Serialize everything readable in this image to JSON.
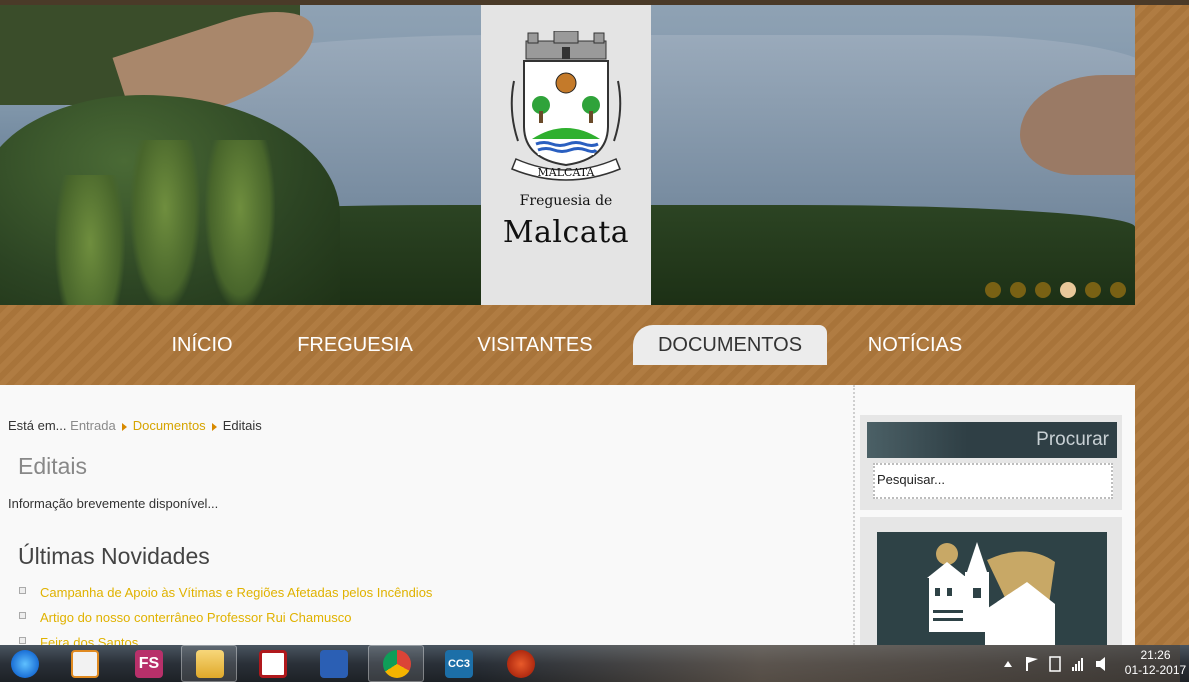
{
  "brand": {
    "subtitle": "Freguesia de",
    "name": "Malcata",
    "crest_ribbon": "MALCATA"
  },
  "slider": {
    "total": 6,
    "active": 4
  },
  "nav": {
    "items": [
      {
        "label": "INÍCIO"
      },
      {
        "label": "FREGUESIA"
      },
      {
        "label": "VISITANTES"
      },
      {
        "label": "DOCUMENTOS",
        "active": true
      },
      {
        "label": "NOTÍCIAS"
      }
    ]
  },
  "breadcrumb": {
    "prefix": "Está em...",
    "home": "Entrada",
    "section": "Documentos",
    "current": "Editais"
  },
  "page": {
    "title": "Editais",
    "info": "Informação brevemente disponível..."
  },
  "news": {
    "title": "Últimas Novidades",
    "items": [
      "Campanha de Apoio às Vítimas e Regiões Afetadas pelos Incêndios",
      "Artigo do nosso conterrâneo Professor Rui Chamusco",
      "Feira dos Santos"
    ]
  },
  "search": {
    "title": "Procurar",
    "placeholder": "Pesquisar..."
  },
  "taskbar": {
    "apps": [
      "ie-icon",
      "media-player-icon",
      "fs-icon",
      "file-explorer-icon",
      "acrobat-icon",
      "word-icon",
      "chrome-icon",
      "cc3-icon",
      "ccleaner-icon"
    ],
    "fs_label": "FS",
    "cc3_label": "CC3",
    "time": "21:26",
    "date": "01-12-2017"
  },
  "colors": {
    "accent_gold": "#e0b200",
    "nav_bg": "#a8743a",
    "search_header": "#2f3f45"
  }
}
